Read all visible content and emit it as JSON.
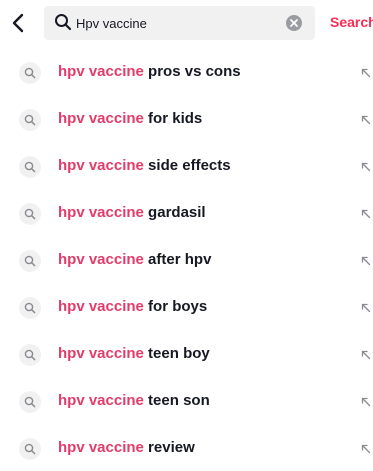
{
  "header": {
    "search_value": "Hpv vaccine",
    "search_button": "Search",
    "icons": {
      "back": "chevron-left-icon",
      "search": "search-icon",
      "clear": "clear-icon"
    }
  },
  "suggestions": [
    {
      "highlight": "hpv vaccine",
      "rest": " pros vs cons"
    },
    {
      "highlight": "hpv vaccine",
      "rest": " for kids"
    },
    {
      "highlight": "hpv vaccine",
      "rest": " side effects"
    },
    {
      "highlight": "hpv vaccine",
      "rest": " gardasil"
    },
    {
      "highlight": "hpv vaccine",
      "rest": " after hpv"
    },
    {
      "highlight": "hpv vaccine",
      "rest": " for boys"
    },
    {
      "highlight": "hpv vaccine",
      "rest": " teen boy"
    },
    {
      "highlight": "hpv vaccine",
      "rest": " teen son"
    },
    {
      "highlight": "hpv vaccine",
      "rest": " review"
    }
  ],
  "colors": {
    "accent": "#fe2c55",
    "highlight": "#e33c6a",
    "text": "#161823",
    "search_bg": "#f1f1f2"
  }
}
